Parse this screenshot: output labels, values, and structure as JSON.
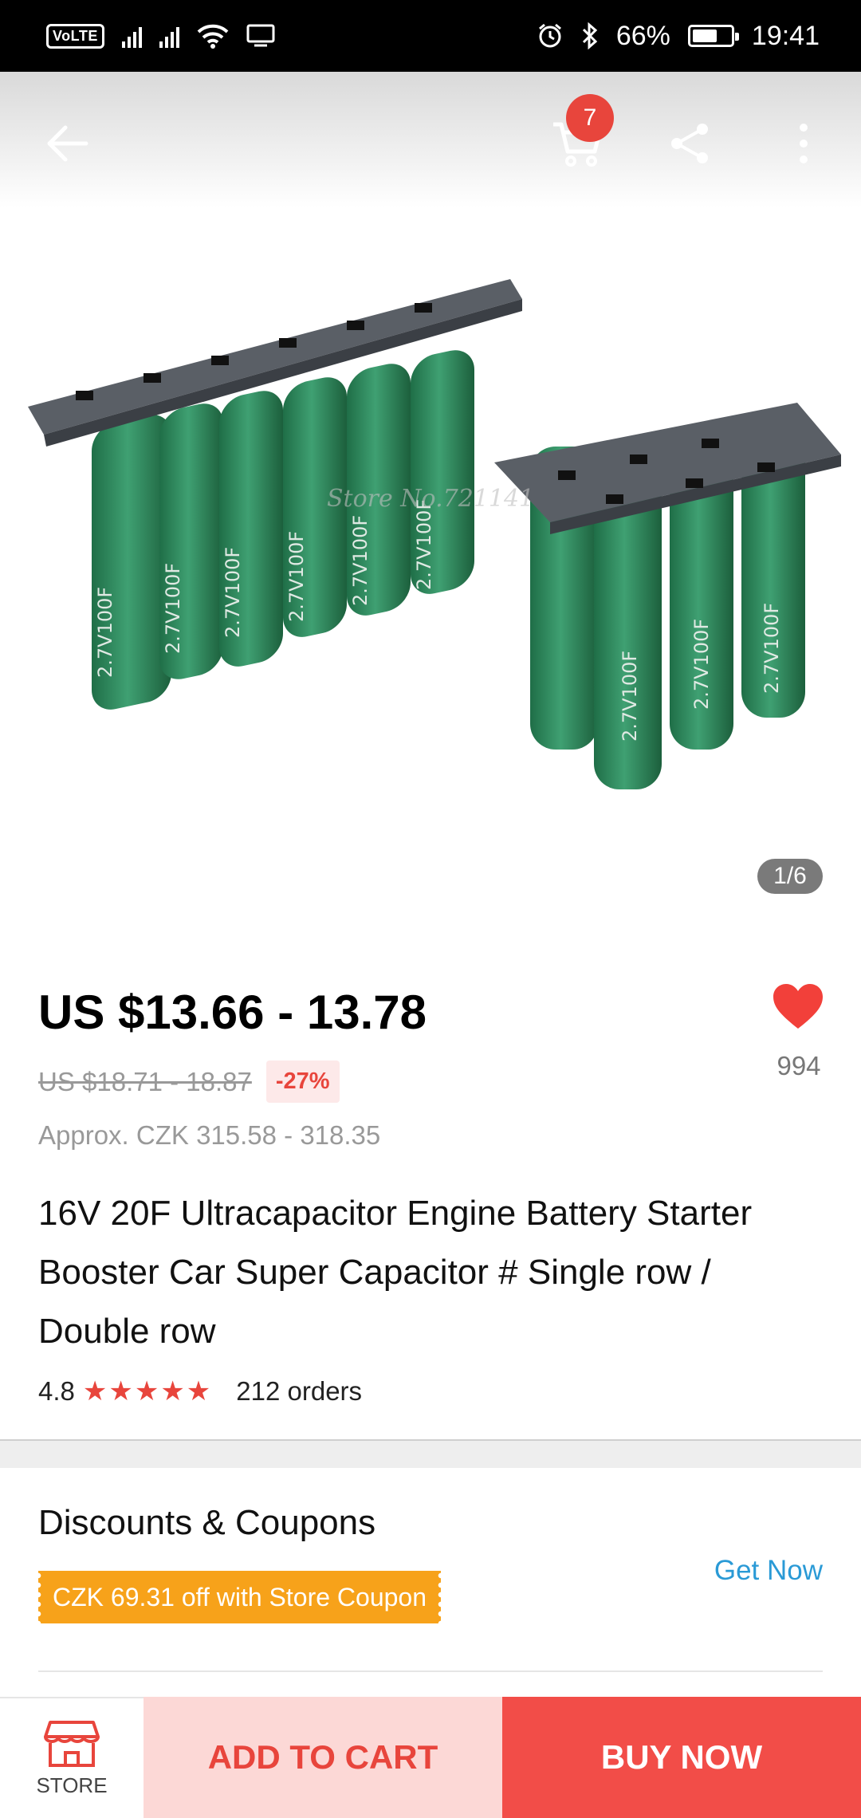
{
  "status_bar": {
    "volte": "VoLTE",
    "battery": "66%",
    "time": "19:41",
    "icons": [
      "signal-icon",
      "signal-icon",
      "wifi-icon",
      "cast-icon",
      "alarm-icon",
      "bluetooth-icon",
      "battery-icon"
    ]
  },
  "top_nav": {
    "icons": [
      "back-arrow-icon",
      "cart-icon",
      "share-icon",
      "more-vertical-icon"
    ],
    "cart_count": "7"
  },
  "gallery": {
    "counter": "1/6",
    "capacitor_label": "2.7V100F",
    "watermark": "Store No.721141"
  },
  "product": {
    "price": "US $13.66 - 13.78",
    "original_price": "US $18.71 - 18.87",
    "discount": "-27%",
    "approx": "Approx. CZK 315.58 - 318.35",
    "title": "16V 20F Ultracapacitor Engine Battery Starter Booster Car Super Capacitor # Single row / Double row",
    "rating": "4.8",
    "stars": "★★★★★",
    "orders": "212 orders",
    "wishlist_count": "994"
  },
  "discounts": {
    "title": "Discounts & Coupons",
    "coupon": "CZK 69.31 off with Store Coupon",
    "get_now": "Get Now"
  },
  "bottom_bar": {
    "store": "STORE",
    "add_to_cart": "ADD TO CART",
    "buy_now": "BUY NOW"
  },
  "colors": {
    "accent_red": "#e8453c",
    "buy_button": "#f24d48",
    "cart_button_bg": "#fcd8d6",
    "coupon_orange": "#f7a21a",
    "link_blue": "#2a9ad6",
    "capacitor_green": "#2f8a5c"
  }
}
